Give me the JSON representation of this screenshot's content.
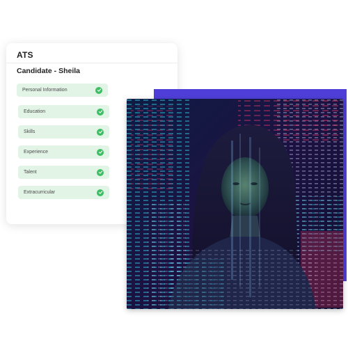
{
  "ats_card": {
    "title": "ATS",
    "candidate": "Candidate - Sheila",
    "sections": [
      {
        "label": "Personal Information",
        "status": "complete"
      },
      {
        "label": "Education",
        "status": "complete"
      },
      {
        "label": "Skills",
        "status": "complete"
      },
      {
        "label": "Experience",
        "status": "complete"
      },
      {
        "label": "Talent",
        "status": "complete"
      },
      {
        "label": "Extracurricular",
        "status": "complete"
      }
    ],
    "check_color": "#3cbf63",
    "pill_color": "#e2f4e6"
  },
  "photo": {
    "icon": "woman-with-code-projection-image",
    "accent_color": "#4f3fd8"
  }
}
